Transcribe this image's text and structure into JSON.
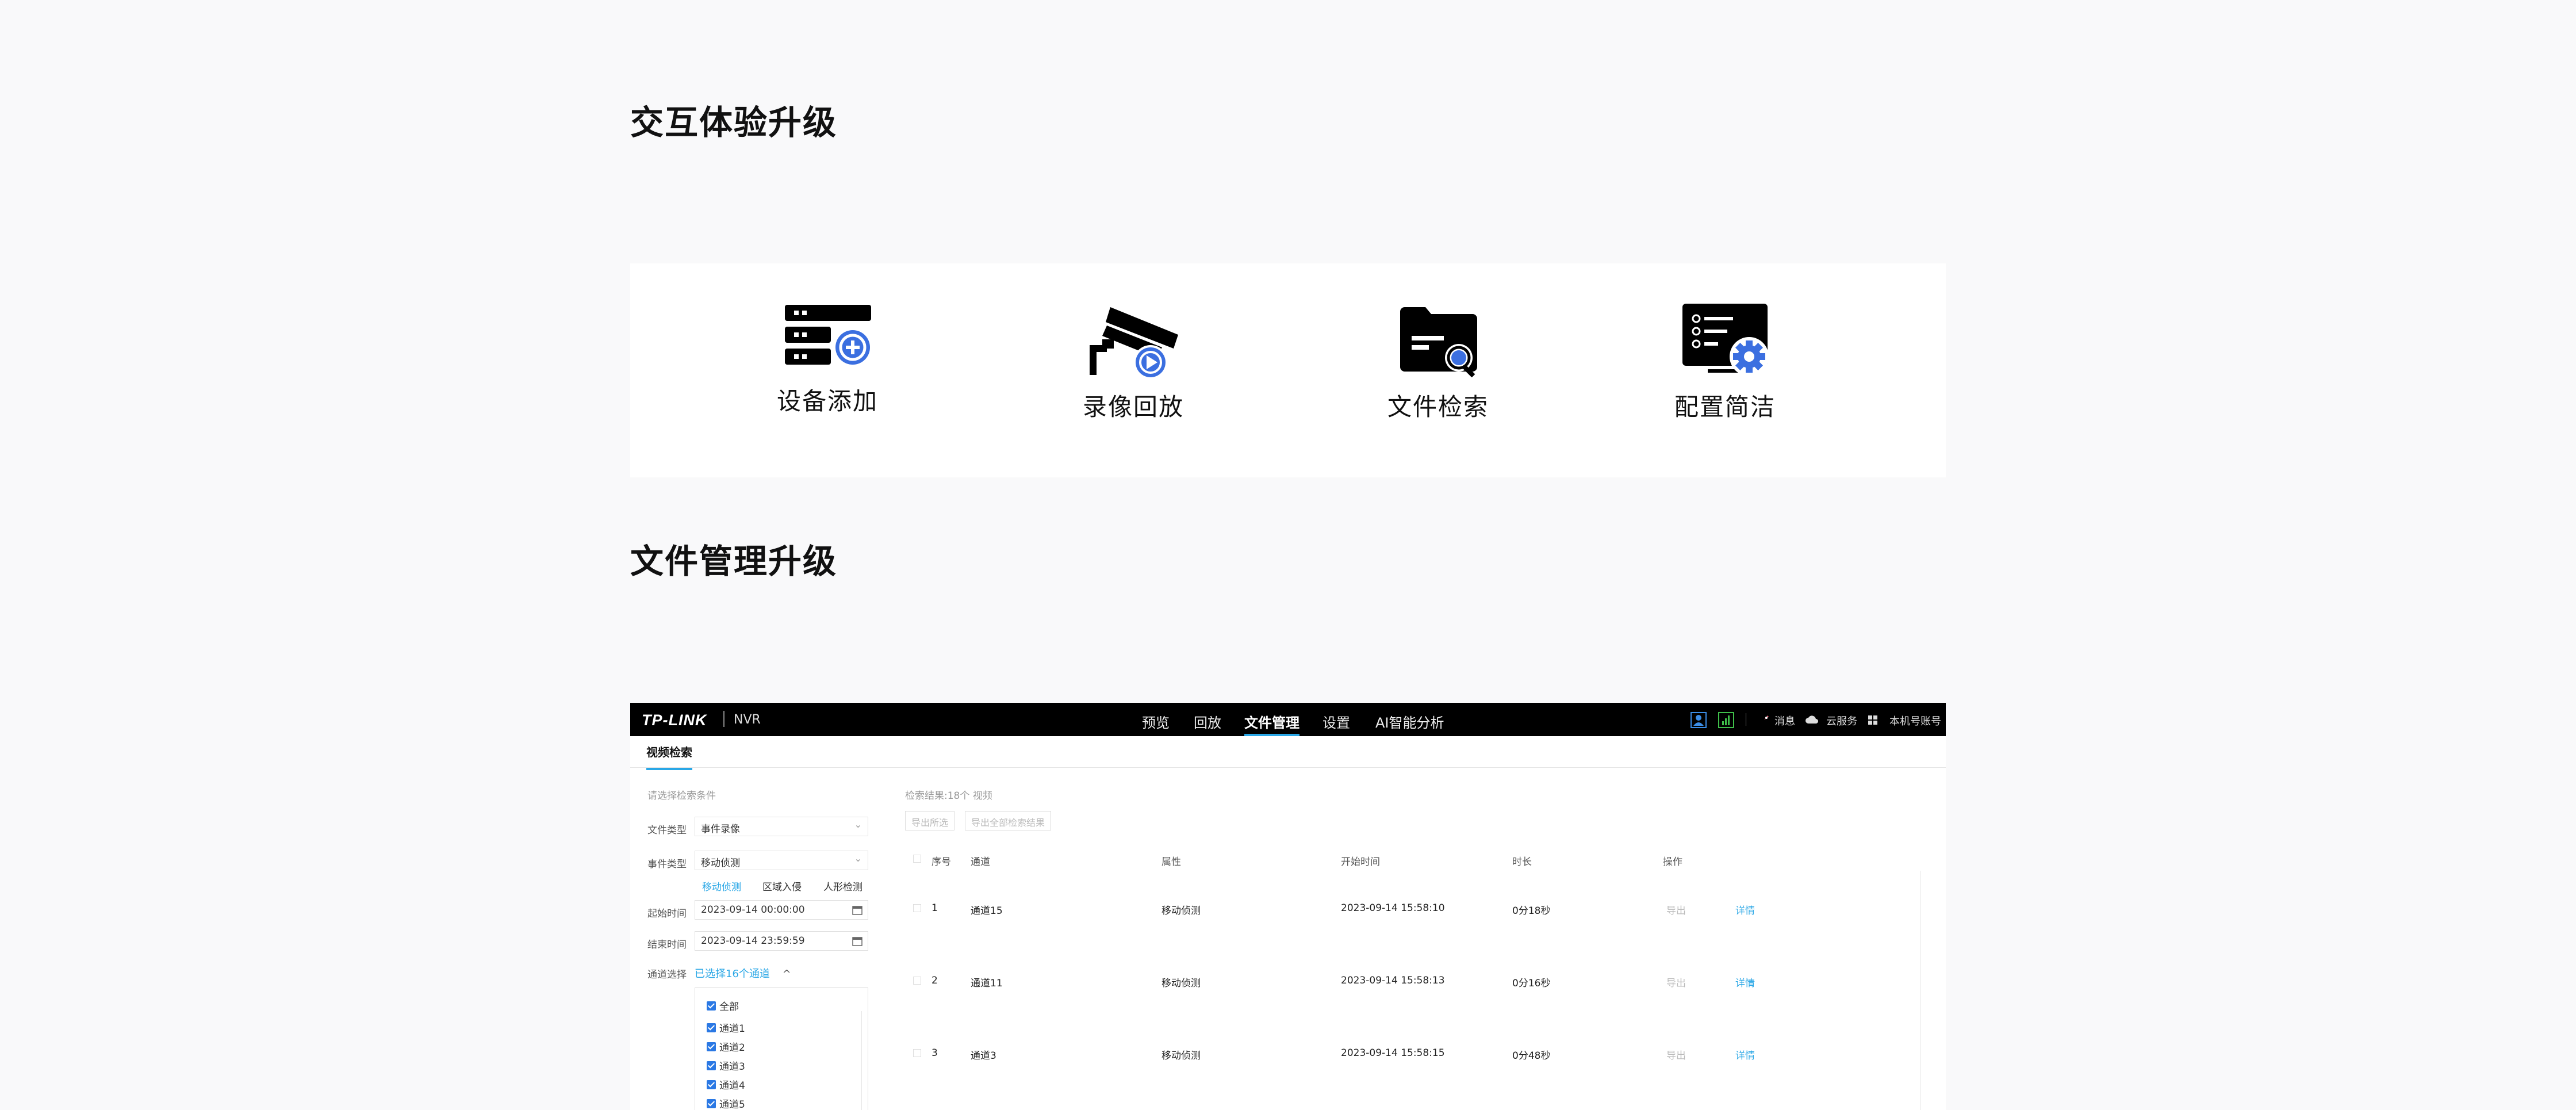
{
  "sections": {
    "interaction_title": "交互体验升级",
    "file_mgmt_title": "文件管理升级"
  },
  "features": [
    {
      "label": "设备添加",
      "icon": "device-add-icon"
    },
    {
      "label": "录像回放",
      "icon": "camera-playback-icon"
    },
    {
      "label": "文件检索",
      "icon": "file-search-icon"
    },
    {
      "label": "配置简洁",
      "icon": "config-icon"
    }
  ],
  "app": {
    "logo": "TP-LINK",
    "product": "NVR",
    "nav_tabs": [
      "预览",
      "回放",
      "文件管理",
      "设置",
      "AI智能分析"
    ],
    "active_tab": "文件管理",
    "nav_right": {
      "messages": "消息",
      "cloud": "云服务",
      "account": "本机号账号"
    },
    "subtab": "视频检索",
    "search_hint": "请选择检索条件",
    "form": {
      "file_type_label": "文件类型",
      "file_type_value": "事件录像",
      "event_type_label": "事件类型",
      "event_type_value": "移动侦测",
      "event_options": [
        "移动侦测",
        "区域入侵",
        "人形检测"
      ],
      "start_label": "起始时间",
      "start_value": "2023-09-14 00:00:00",
      "end_label": "结束时间",
      "end_value": "2023-09-14 23:59:59",
      "channel_label": "通道选择",
      "channel_selected": "已选择16个通道"
    },
    "channel_list": [
      "全部",
      "通道1",
      "通道2",
      "通道3",
      "通道4",
      "通道5"
    ],
    "result_summary": "检索结果:18个 视频",
    "buttons": {
      "export_selected": "导出所选",
      "export_all": "导出全部检索结果"
    },
    "table": {
      "headers": [
        "序号",
        "通道",
        "属性",
        "开始时间",
        "时长",
        "操作"
      ],
      "rows": [
        {
          "no": "1",
          "channel": "通道15",
          "attr": "移动侦测",
          "start": "2023-09-14 15:58:10",
          "duration": "0分18秒",
          "export": "导出",
          "detail": "详情"
        },
        {
          "no": "2",
          "channel": "通道11",
          "attr": "移动侦测",
          "start": "2023-09-14 15:58:13",
          "duration": "0分16秒",
          "export": "导出",
          "detail": "详情"
        },
        {
          "no": "3",
          "channel": "通道3",
          "attr": "移动侦测",
          "start": "2023-09-14 15:58:15",
          "duration": "0分48秒",
          "export": "导出",
          "detail": "详情"
        }
      ]
    }
  },
  "colors": {
    "accent": "#2aa7e6",
    "icon_blue": "#3b6fe0"
  }
}
